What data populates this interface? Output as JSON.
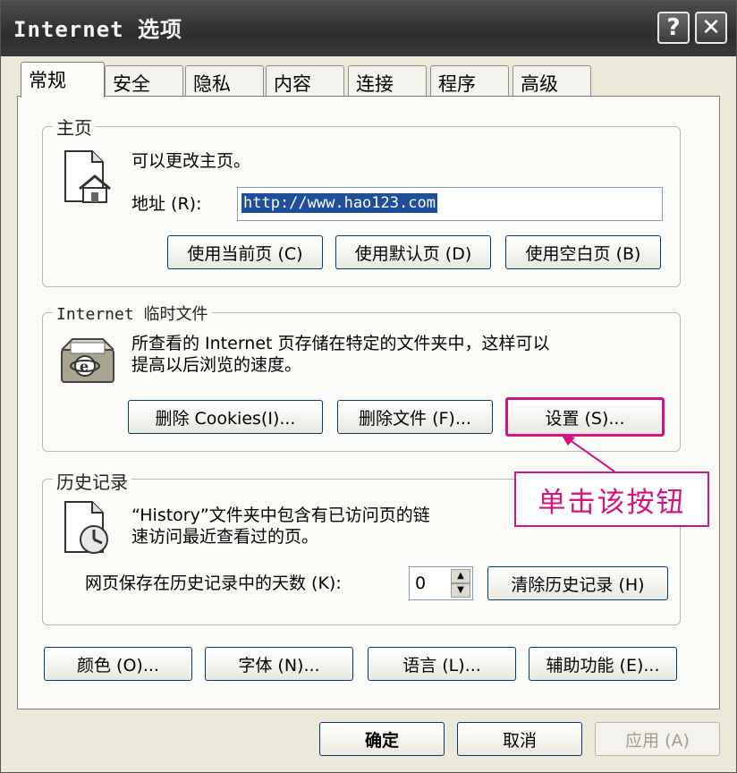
{
  "window": {
    "title": "Internet 选项"
  },
  "titlebar": {
    "help_glyph": "?",
    "close_glyph": "✕"
  },
  "tabs": [
    {
      "label": "常规"
    },
    {
      "label": "安全"
    },
    {
      "label": "隐私"
    },
    {
      "label": "内容"
    },
    {
      "label": "连接"
    },
    {
      "label": "程序"
    },
    {
      "label": "高级"
    }
  ],
  "homepage": {
    "group_title": "主页",
    "description": "可以更改主页。",
    "address_label": "地址 (R):",
    "address_value": "http://www.hao123.com",
    "btn_current": "使用当前页 (C)",
    "btn_default": "使用默认页 (D)",
    "btn_blank": "使用空白页 (B)"
  },
  "temp_files": {
    "group_title": "Internet 临时文件",
    "desc_line1": "所查看的 Internet 页存储在特定的文件夹中，这样可以",
    "desc_line2": "提高以后浏览的速度。",
    "btn_cookies": "删除 Cookies(I)...",
    "btn_files": "删除文件 (F)...",
    "btn_settings": "设置 (S)..."
  },
  "history": {
    "group_title": "历史记录",
    "desc_line1": "“History”文件夹中包含有已访问页的链",
    "desc_line2": "速访问最近查看过的页。",
    "days_label": "网页保存在历史记录中的天数 (K):",
    "days_value": "0",
    "btn_clear": "清除历史记录 (H)"
  },
  "bottom_buttons": {
    "colors": "颜色 (O)...",
    "fonts": "字体 (N)...",
    "languages": "语言 (L)...",
    "accessibility": "辅助功能 (E)..."
  },
  "dialog_buttons": {
    "ok": "确定",
    "cancel": "取消",
    "apply": "应用 (A)"
  },
  "annotation": {
    "callout_text": "单击该按钮"
  },
  "colors": {
    "highlight": "#d4147f",
    "titlebar": "#3a3a3a",
    "selection": "#1f4f9c"
  },
  "icons": {
    "homepage": "house-page-icon",
    "temp_files": "ie-folder-icon",
    "history": "history-clock-icon",
    "spinner_up": "arrow-up-icon",
    "spinner_down": "arrow-down-icon"
  }
}
